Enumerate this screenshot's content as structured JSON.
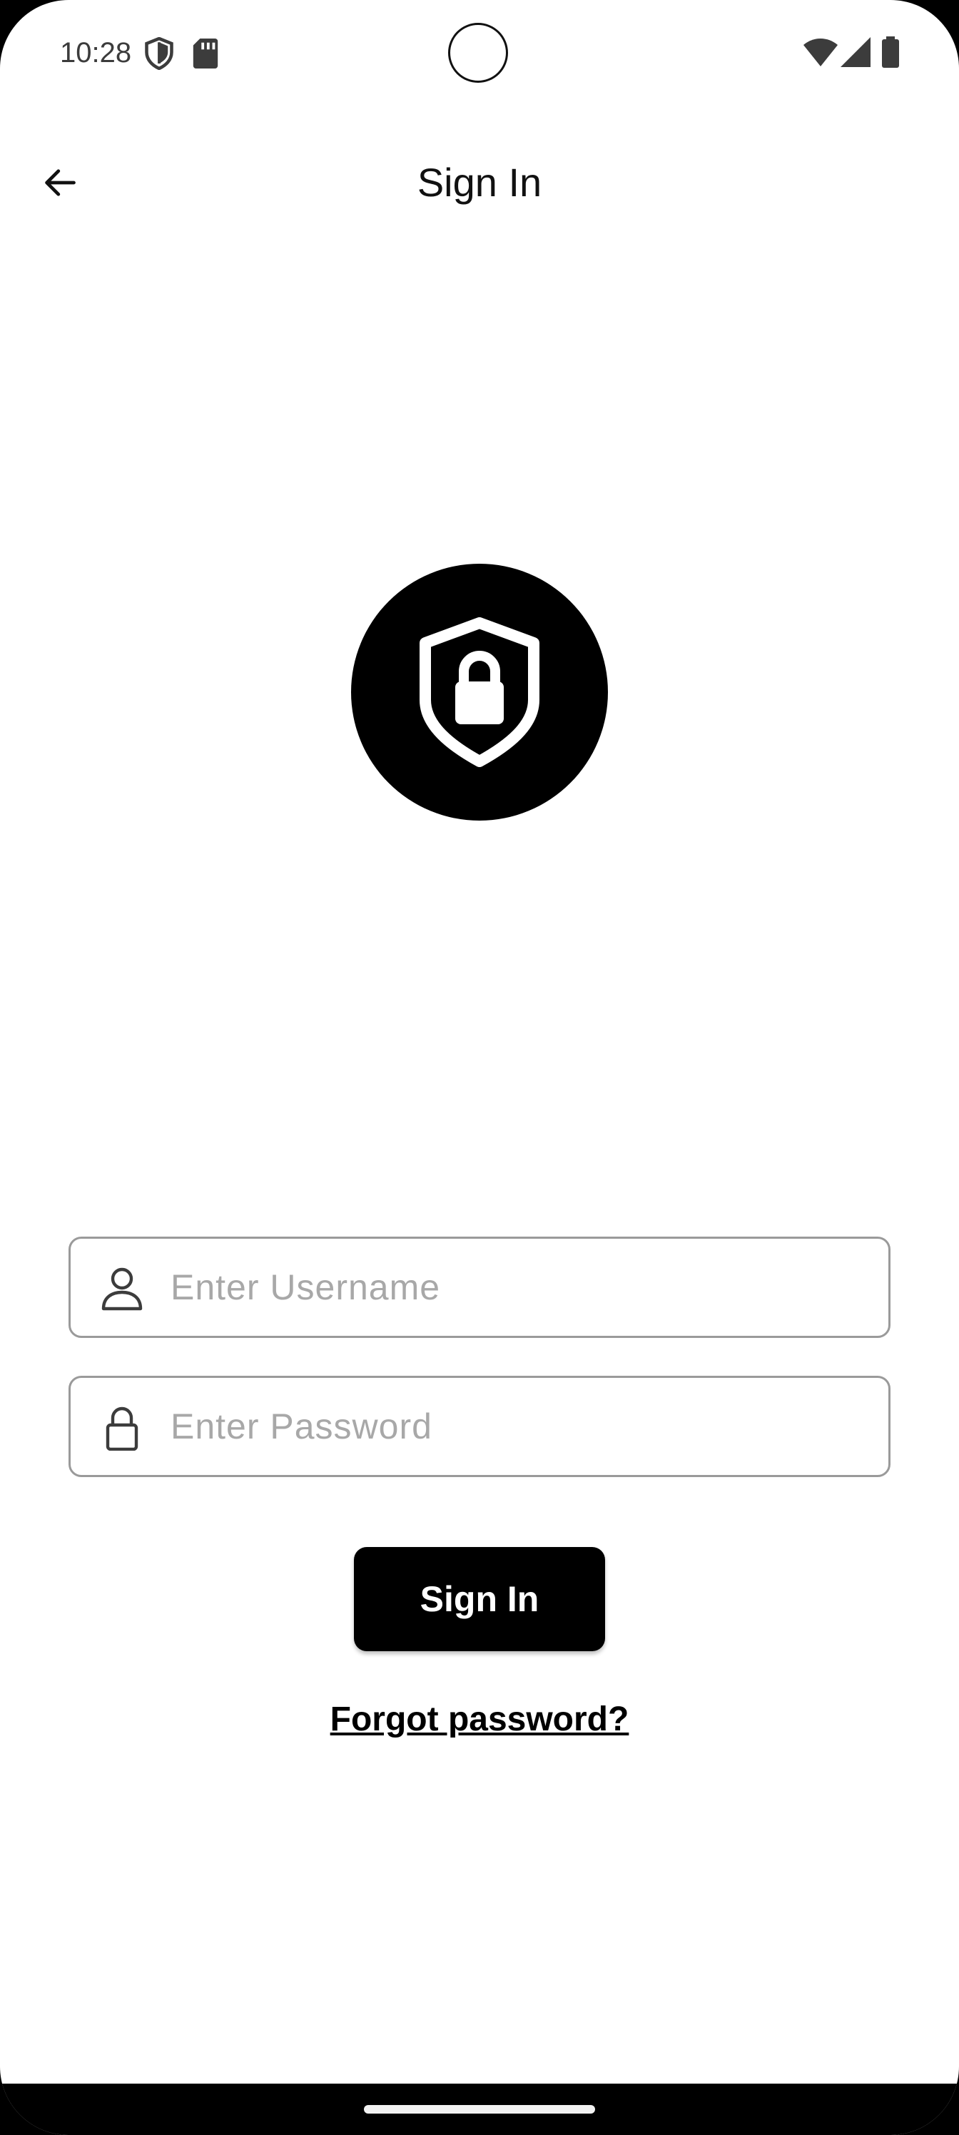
{
  "status_bar": {
    "time": "10:28",
    "icons": [
      "shield-icon",
      "sd-card-icon",
      "wifi-icon",
      "cell-signal-icon",
      "battery-icon"
    ]
  },
  "app_bar": {
    "title": "Sign In",
    "back_icon": "arrow-left-icon"
  },
  "logo": {
    "icon": "shield-lock-icon"
  },
  "form": {
    "username": {
      "placeholder": "Enter Username",
      "value": "",
      "icon": "person-icon"
    },
    "password": {
      "placeholder": "Enter Password",
      "value": "",
      "icon": "lock-icon"
    },
    "submit_label": "Sign In",
    "forgot_label": "Forgot password?"
  },
  "colors": {
    "primary": "#000000",
    "background": "#ffffff",
    "input_border": "#9a9a9a",
    "placeholder": "#a8a8a8"
  }
}
